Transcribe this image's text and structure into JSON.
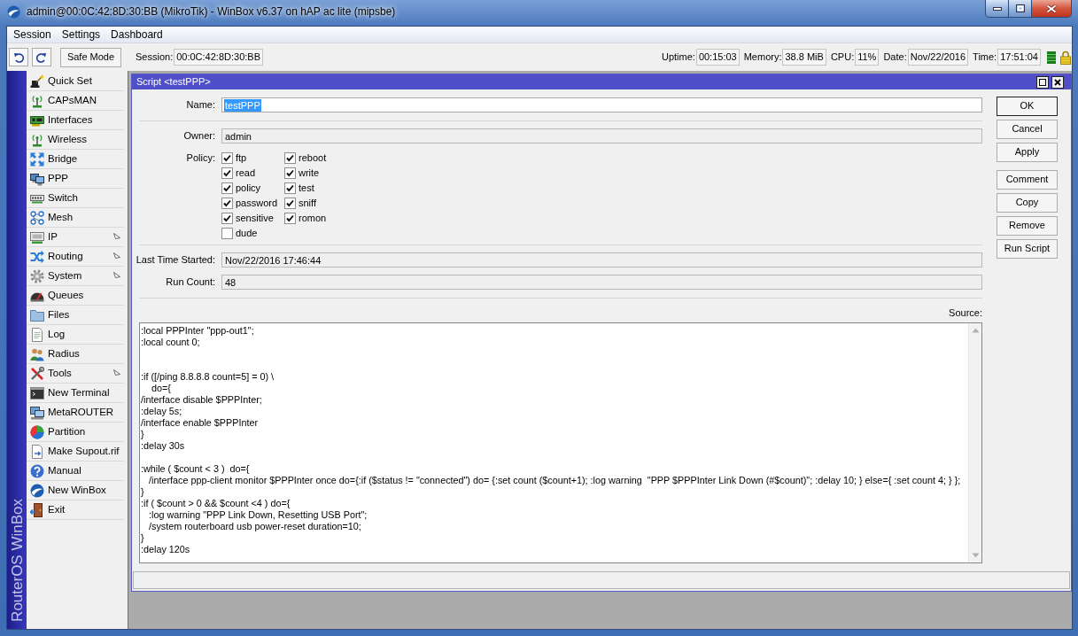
{
  "window": {
    "title": "admin@00:0C:42:8D:30:BB (MikroTik) - WinBox v6.37 on hAP ac lite (mipsbe)"
  },
  "menu": [
    {
      "label": "Session"
    },
    {
      "label": "Settings"
    },
    {
      "label": "Dashboard"
    }
  ],
  "toolbar": {
    "safe_mode": "Safe Mode",
    "session": {
      "label": "Session:",
      "value": "00:0C:42:8D:30:BB"
    },
    "stats": [
      {
        "label": "Uptime:",
        "value": "00:15:03"
      },
      {
        "label": "Memory:",
        "value": "38.8 MiB"
      },
      {
        "label": "CPU:",
        "value": "11%"
      },
      {
        "label": "Date:",
        "value": "Nov/22/2016"
      },
      {
        "label": "Time:",
        "value": "17:51:04"
      }
    ]
  },
  "sidebar": {
    "brand": "RouterOS WinBox",
    "items": [
      {
        "label": "Quick Set",
        "submenu": false
      },
      {
        "label": "CAPsMAN",
        "submenu": false
      },
      {
        "label": "Interfaces",
        "submenu": false
      },
      {
        "label": "Wireless",
        "submenu": false
      },
      {
        "label": "Bridge",
        "submenu": false
      },
      {
        "label": "PPP",
        "submenu": false
      },
      {
        "label": "Switch",
        "submenu": false
      },
      {
        "label": "Mesh",
        "submenu": false
      },
      {
        "label": "IP",
        "submenu": true
      },
      {
        "label": "Routing",
        "submenu": true
      },
      {
        "label": "System",
        "submenu": true
      },
      {
        "label": "Queues",
        "submenu": false
      },
      {
        "label": "Files",
        "submenu": false
      },
      {
        "label": "Log",
        "submenu": false
      },
      {
        "label": "Radius",
        "submenu": false
      },
      {
        "label": "Tools",
        "submenu": true
      },
      {
        "label": "New Terminal",
        "submenu": false
      },
      {
        "label": "MetaROUTER",
        "submenu": false
      },
      {
        "label": "Partition",
        "submenu": false
      },
      {
        "label": "Make Supout.rif",
        "submenu": false
      },
      {
        "label": "Manual",
        "submenu": false
      },
      {
        "label": "New WinBox",
        "submenu": false
      },
      {
        "label": "Exit",
        "submenu": false
      }
    ]
  },
  "script_window": {
    "title": "Script <testPPP>",
    "rows": [
      {
        "kind": "text",
        "label": "Name:",
        "value": "testPPP",
        "read_only": false,
        "highlighted": true,
        "divider_after": true
      },
      {
        "kind": "text",
        "label": "Owner:",
        "value": "admin",
        "read_only": true,
        "highlighted": false,
        "divider_after": false
      },
      {
        "kind": "checks",
        "label": "Policy:",
        "options": [
          {
            "label": "ftp",
            "checked": true
          },
          {
            "label": "reboot",
            "checked": true
          },
          {
            "label": "read",
            "checked": true
          },
          {
            "label": "write",
            "checked": true
          },
          {
            "label": "policy",
            "checked": true
          },
          {
            "label": "test",
            "checked": true
          },
          {
            "label": "password",
            "checked": true
          },
          {
            "label": "sniff",
            "checked": true
          },
          {
            "label": "sensitive",
            "checked": true
          },
          {
            "label": "romon",
            "checked": true
          },
          {
            "label": "dude",
            "checked": false
          }
        ],
        "divider_after": true
      },
      {
        "kind": "text",
        "label": "Last Time Started:",
        "value": "Nov/22/2016 17:46:44",
        "read_only": true,
        "highlighted": false,
        "divider_after": false
      },
      {
        "kind": "text",
        "label": "Run Count:",
        "value": "48",
        "read_only": true,
        "highlighted": false,
        "divider_after": true
      }
    ],
    "source": {
      "label": "Source:",
      "text": ":local PPPInter \"ppp-out1\";\n:local count 0;\n\n\n:if ([/ping 8.8.8.8 count=5] = 0) \\\n    do={\n/interface disable $PPPInter;\n:delay 5s;\n/interface enable $PPPInter\n}\n:delay 30s\n\n:while ( $count < 3 )  do={\n   /interface ppp-client monitor $PPPInter once do={:if ($status != \"connected\") do= {:set count ($count+1); :log warning  \"PPP $PPPInter Link Down (#$count)\"; :delay 10; } else={ :set count 4; } };\n}\n:if ( $count > 0 && $count <4 ) do={\n   :log warning \"PPP Link Down, Resetting USB Port\";\n   /system routerboard usb power-reset duration=10;\n}\n:delay 120s"
    },
    "button_groups": [
      [
        {
          "label": "OK",
          "default": true
        },
        {
          "label": "Cancel",
          "default": false
        },
        {
          "label": "Apply",
          "default": false
        }
      ],
      [
        {
          "label": "Comment",
          "default": false
        },
        {
          "label": "Copy",
          "default": false
        },
        {
          "label": "Remove",
          "default": false
        },
        {
          "label": "Run Script",
          "default": false
        }
      ]
    ]
  }
}
